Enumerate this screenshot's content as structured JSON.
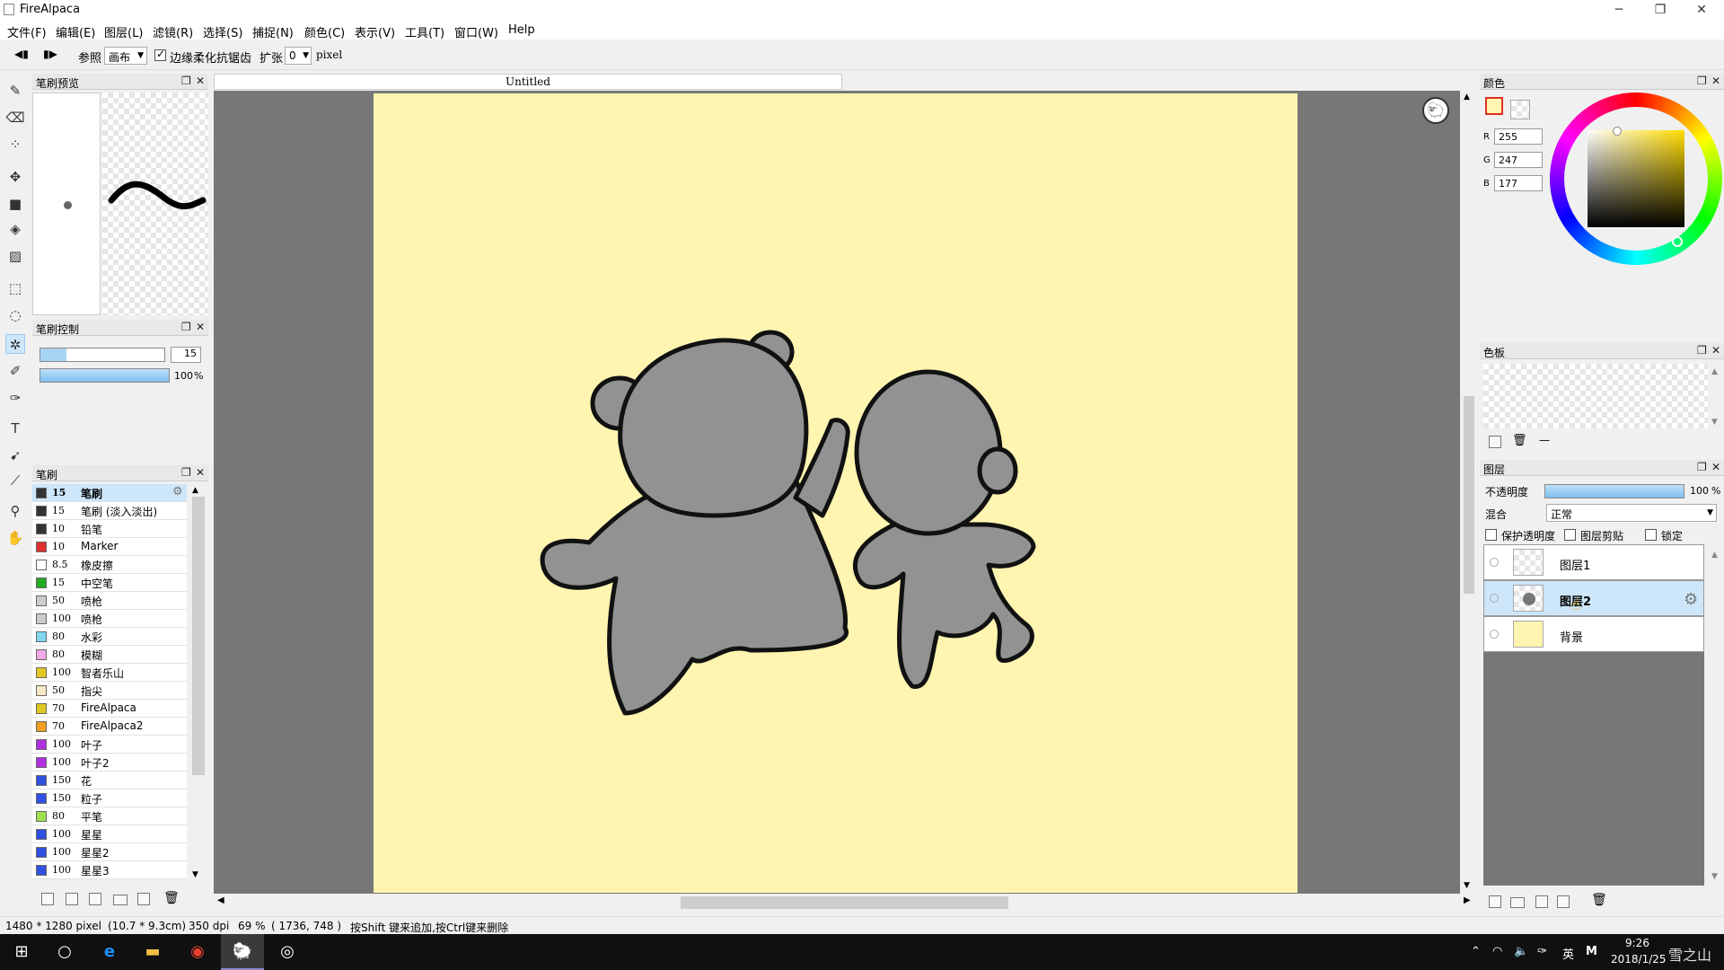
{
  "app": {
    "title": "FireAlpaca"
  },
  "window_controls": {
    "minimize": "─",
    "restore": "❐",
    "close": "✕"
  },
  "menu": [
    "文件(F)",
    "编辑(E)",
    "图层(L)",
    "滤镜(R)",
    "选择(S)",
    "捕捉(N)",
    "颜色(C)",
    "表示(V)",
    "工具(T)",
    "窗口(W)",
    "Help"
  ],
  "toolbar": {
    "ref_label": "参照",
    "ref_value": "画布",
    "antialias_label": "边缘柔化抗锯齿",
    "antialias_checked": true,
    "expand_label": "扩张",
    "expand_value": "0",
    "unit": "pixel"
  },
  "panels": {
    "brush_preview": "笔刷预览",
    "brush_control": "笔刷控制",
    "brush": "笔刷",
    "color": "颜色",
    "palette": "色板",
    "layer": "图层"
  },
  "brush_control": {
    "size": "15",
    "opacity": "100",
    "opacity_unit": "%",
    "size_fill": 0.21,
    "opacity_fill": 1.0
  },
  "brushes": [
    {
      "size": "15",
      "name": "笔刷",
      "color": "#333333",
      "active": true
    },
    {
      "size": "15",
      "name": "笔刷 (淡入淡出)",
      "color": "#333333"
    },
    {
      "size": "10",
      "name": "铅笔",
      "color": "#333333"
    },
    {
      "size": "10",
      "name": "Marker",
      "color": "#e03030"
    },
    {
      "size": "8.5",
      "name": "橡皮擦",
      "color": "#ffffff"
    },
    {
      "size": "15",
      "name": "中空笔",
      "color": "#22aa22"
    },
    {
      "size": "50",
      "name": "喷枪",
      "color": "#cccccc"
    },
    {
      "size": "100",
      "name": "喷枪",
      "color": "#cccccc"
    },
    {
      "size": "80",
      "name": "水彩",
      "color": "#7fd8f0"
    },
    {
      "size": "80",
      "name": "模糊",
      "color": "#f0a8e8"
    },
    {
      "size": "100",
      "name": "智者乐山",
      "color": "#e0c820"
    },
    {
      "size": "50",
      "name": "指尖",
      "color": "#f8e8c8"
    },
    {
      "size": "70",
      "name": "FireAlpaca",
      "color": "#e0c820"
    },
    {
      "size": "70",
      "name": "FireAlpaca2",
      "color": "#f0a020"
    },
    {
      "size": "100",
      "name": "叶子",
      "color": "#b030e0"
    },
    {
      "size": "100",
      "name": "叶子2",
      "color": "#b030e0"
    },
    {
      "size": "150",
      "name": "花",
      "color": "#3050e0"
    },
    {
      "size": "150",
      "name": "粒子",
      "color": "#3050e0"
    },
    {
      "size": "80",
      "name": "平笔",
      "color": "#a0e050"
    },
    {
      "size": "100",
      "name": "星星",
      "color": "#3050e0"
    },
    {
      "size": "100",
      "name": "星星2",
      "color": "#3050e0"
    },
    {
      "size": "100",
      "name": "星星3",
      "color": "#3050e0"
    }
  ],
  "document": {
    "tab": "Untitled"
  },
  "color": {
    "r_label": "R",
    "g_label": "G",
    "b_label": "B",
    "r": "255",
    "g": "247",
    "b": "177",
    "fg": "#fff7b1",
    "accent": "#e03020"
  },
  "layer_panel": {
    "opacity_label": "不透明度",
    "opacity": "100",
    "opacity_unit": "%",
    "blend_label": "混合",
    "blend_value": "正常",
    "protect_alpha": "保护透明度",
    "clipping": "图层剪贴",
    "lock": "锁定",
    "layers": [
      {
        "name": "图层1",
        "active": false
      },
      {
        "name": "图层2",
        "active": true
      },
      {
        "name": "背景",
        "active": false
      }
    ]
  },
  "status": {
    "size": "1480 * 1280 pixel",
    "physical": "(10.7 * 9.3cm)",
    "dpi": "350 dpi",
    "zoom": "69 %",
    "cursor": "( 1736, 748 )",
    "hint": "按Shift 键来追加,按Ctrl键来删除"
  },
  "taskbar": {
    "time": "9:26",
    "date": "2018/1/25",
    "ime": "英",
    "tray_m": "M",
    "watermark": "雪之山"
  },
  "palette_dash": "—"
}
